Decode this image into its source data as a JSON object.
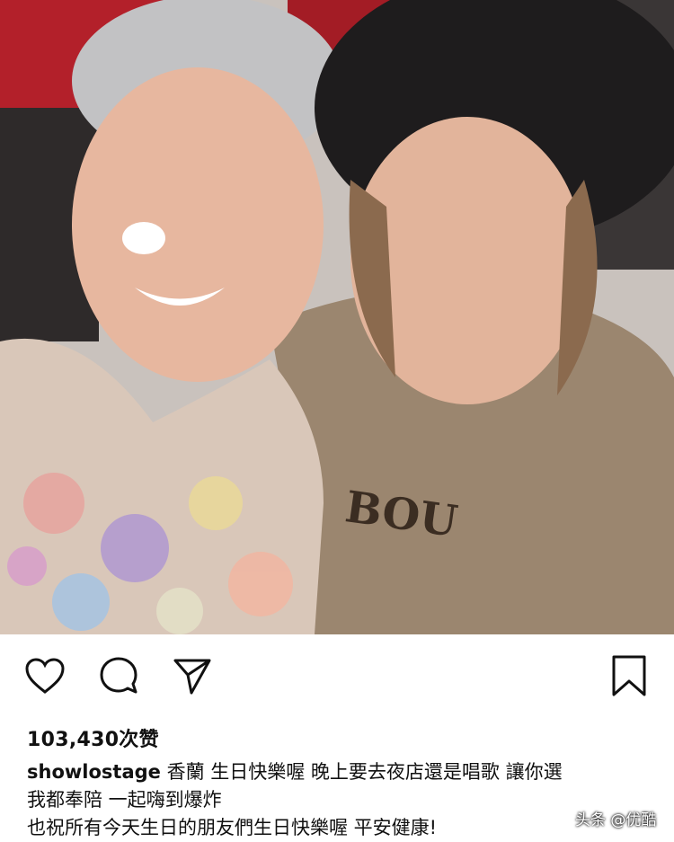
{
  "post": {
    "likes_text": "103,430次赞",
    "username": "showlostage",
    "caption_line1": "香蘭 生日快樂喔 晚上要去夜店還是唱歌 讓你選",
    "caption_line2": "我都奉陪 一起嗨到爆炸",
    "caption_line3": "也祝所有今天生日的朋友們生日快樂喔 平安健康!",
    "shirt_text": "BOU"
  },
  "actions": {
    "like_icon": "heart-outline-icon",
    "comment_icon": "comment-bubble-icon",
    "share_icon": "paper-plane-icon",
    "save_icon": "bookmark-outline-icon"
  },
  "watermark": {
    "text": "头条 @优酷"
  },
  "colors": {
    "accent_red": "#c8232c",
    "text": "#111111",
    "background": "#ffffff"
  }
}
